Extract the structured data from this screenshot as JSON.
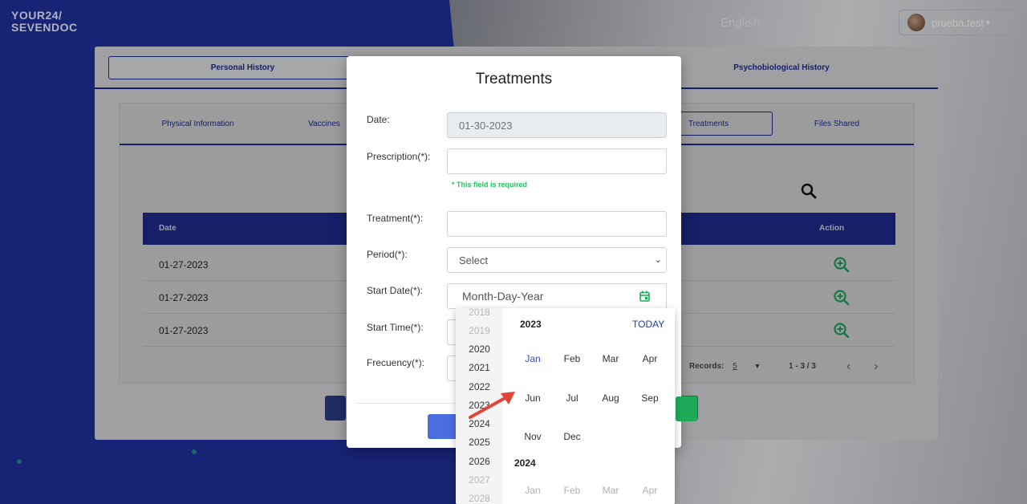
{
  "header": {
    "logo_line1": "YOUR24/",
    "logo_line2": "SEVENDOC",
    "language": "English",
    "username": "prueba.test"
  },
  "top_tabs": [
    "Personal History",
    "",
    "Psychobiological History"
  ],
  "sub_tabs": [
    "Physical Information",
    "Vaccines",
    "Treatments",
    "Files Shared"
  ],
  "table": {
    "headers": [
      "Date",
      "Action"
    ],
    "rows": [
      "01-27-2023",
      "01-27-2023",
      "01-27-2023"
    ]
  },
  "pagination": {
    "records_label": "Records:",
    "records_value": "5",
    "range": "1 - 3 / 3",
    "prev": "‹",
    "next": "›"
  },
  "modal": {
    "title": "Treatments",
    "fields": {
      "date_label": "Date:",
      "date_value": "01-30-2023",
      "prescription_label": "Prescription(*):",
      "prescription_error": "* This field is required",
      "treatment_label": "Treatment(*):",
      "period_label": "Period(*):",
      "period_value": "Select",
      "start_date_label": "Start Date(*):",
      "start_date_placeholder": "Month-Day-Year",
      "start_time_label": "Start Time(*):",
      "frequency_label": "Frecuency(*):"
    }
  },
  "date_picker": {
    "years": [
      "2018",
      "2019",
      "2020",
      "2021",
      "2022",
      "2023",
      "2024",
      "2025",
      "2026",
      "2027",
      "2028"
    ],
    "current_year": "2023",
    "today_label": "TODAY",
    "months": [
      "Jan",
      "Feb",
      "Mar",
      "Apr",
      "Jun",
      "Jul",
      "Aug",
      "Sep",
      "Nov",
      "Dec"
    ],
    "next_year": "2024",
    "next_months": [
      "Jan",
      "Feb",
      "Mar",
      "Apr"
    ]
  },
  "colors": {
    "brand_blue": "#1e2a8a",
    "success_green": "#22c55e",
    "annotation_arrow": "#e0443a"
  }
}
